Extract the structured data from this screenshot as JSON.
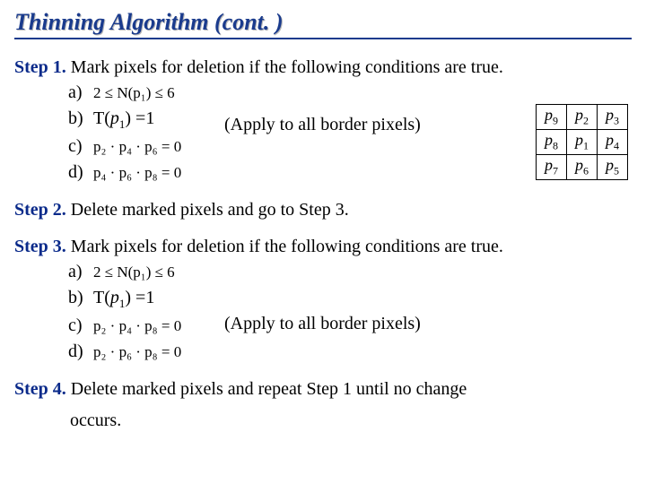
{
  "title": "Thinning Algorithm (cont. )",
  "steps": {
    "s1": {
      "label": "Step 1.",
      "text": "Mark pixels for deletion if the following conditions are true.",
      "items": {
        "a": {
          "tag": "a)",
          "cond": "2 ≤ N(p₁) ≤ 6"
        },
        "b": {
          "tag": "b)",
          "cond_pre": "T(",
          "cond_var": "p",
          "cond_sub": "1",
          "cond_post": ") =1"
        },
        "c": {
          "tag": "c)",
          "cond": "p₂ · p₄ · p₆ = 0"
        },
        "d": {
          "tag": "d)",
          "cond": "p₄ · p₆ · p₈ = 0"
        }
      },
      "apply_note": "(Apply to all border pixels)"
    },
    "s2": {
      "label": "Step 2.",
      "text": "Delete marked pixels and go to Step 3."
    },
    "s3": {
      "label": "Step 3.",
      "text": "Mark pixels for deletion if the following conditions are true.",
      "items": {
        "a": {
          "tag": "a)",
          "cond": "2 ≤ N(p₁) ≤ 6"
        },
        "b": {
          "tag": "b)",
          "cond_pre": "T(",
          "cond_var": "p",
          "cond_sub": "1",
          "cond_post": ") =1"
        },
        "c": {
          "tag": "c)",
          "cond": "p₂ · p₄ · p₈ = 0"
        },
        "d": {
          "tag": "d)",
          "cond": "p₂ · p₆ · p₈ = 0"
        }
      },
      "apply_note": "(Apply to all border pixels)"
    },
    "s4": {
      "label": "Step 4.",
      "text": "Delete marked pixels and repeat Step 1 until no change",
      "text2": "occurs."
    }
  },
  "pixel_grid": {
    "r0": {
      "c0": {
        "p": "p",
        "s": "9"
      },
      "c1": {
        "p": "p",
        "s": "2"
      },
      "c2": {
        "p": "p",
        "s": "3"
      }
    },
    "r1": {
      "c0": {
        "p": "p",
        "s": "8"
      },
      "c1": {
        "p": "p",
        "s": "1"
      },
      "c2": {
        "p": "p",
        "s": "4"
      }
    },
    "r2": {
      "c0": {
        "p": "p",
        "s": "7"
      },
      "c1": {
        "p": "p",
        "s": "6"
      },
      "c2": {
        "p": "p",
        "s": "5"
      }
    }
  }
}
